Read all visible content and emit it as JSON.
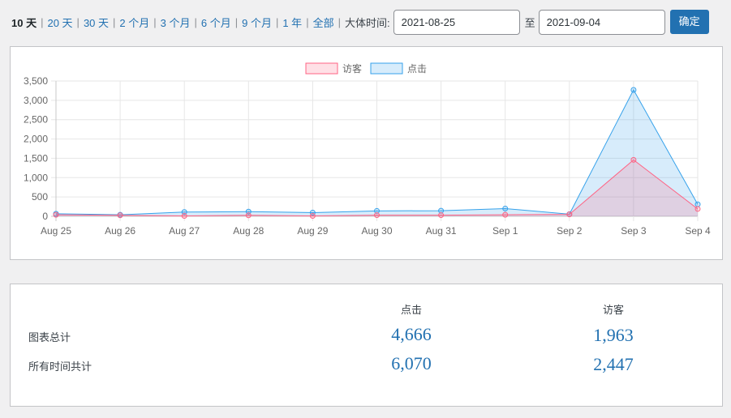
{
  "range_links": [
    {
      "label": "10 天",
      "current": true
    },
    {
      "label": "20 天",
      "current": false
    },
    {
      "label": "30 天",
      "current": false
    },
    {
      "label": "2 个月",
      "current": false
    },
    {
      "label": "3 个月",
      "current": false
    },
    {
      "label": "6 个月",
      "current": false
    },
    {
      "label": "9 个月",
      "current": false
    },
    {
      "label": "1 年",
      "current": false
    },
    {
      "label": "全部",
      "current": false
    }
  ],
  "date_range": {
    "label": "大体时间:",
    "from": "2021-08-25",
    "to_label": "至",
    "to": "2021-09-04",
    "confirm_label": "确定"
  },
  "colors": {
    "visitors_line": "#ff6384",
    "visitors_fill": "rgba(255,99,132,0.2)",
    "hits_line": "#36a2eb",
    "hits_fill": "rgba(54,162,235,0.2)",
    "link": "#2271b1"
  },
  "chart_data": {
    "type": "area",
    "x": [
      "Aug 25",
      "Aug 26",
      "Aug 27",
      "Aug 28",
      "Aug 29",
      "Aug 30",
      "Aug 31",
      "Sep 1",
      "Sep 2",
      "Sep 3",
      "Sep 4"
    ],
    "series": [
      {
        "name": "访客",
        "values": [
          40,
          25,
          10,
          25,
          10,
          30,
          30,
          40,
          50,
          1460,
          190
        ]
      },
      {
        "name": "点击",
        "values": [
          65,
          40,
          110,
          120,
          95,
          140,
          145,
          200,
          55,
          3270,
          310
        ]
      }
    ],
    "ylim": [
      0,
      3500
    ],
    "yticks": [
      "0",
      "500",
      "1,000",
      "1,500",
      "2,000",
      "2,500",
      "3,000",
      "3,500"
    ],
    "grid": true,
    "legend_position": "top-center"
  },
  "totals": {
    "headers": {
      "hits": "点击",
      "visitors": "访客"
    },
    "rows": [
      {
        "label": "图表总计",
        "hits": "4,666",
        "visitors": "1,963"
      },
      {
        "label": "所有时间共计",
        "hits": "6,070",
        "visitors": "2,447"
      }
    ]
  }
}
